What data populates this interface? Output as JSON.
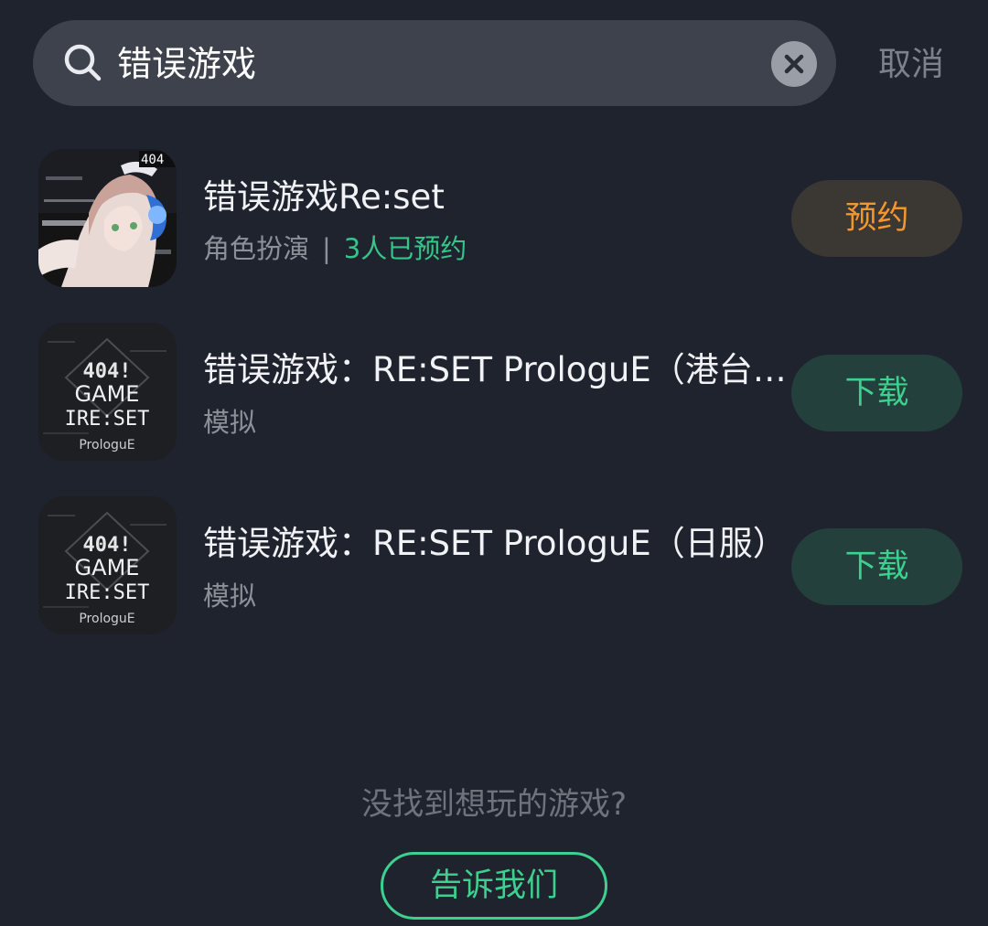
{
  "search": {
    "query": "错误游戏",
    "cancel_label": "取消"
  },
  "results": [
    {
      "title": "错误游戏Re:set",
      "category": "角色扮演",
      "separator": "|",
      "reservations": "3人已预约",
      "action_label": "预约"
    },
    {
      "title": "错误游戏：RE:SET ProloguE（港台…",
      "category": "模拟",
      "action_label": "下载",
      "icon_text": [
        "404!",
        "GAME",
        "IRE:SET",
        "ProloguE"
      ]
    },
    {
      "title": "错误游戏：RE:SET ProloguE（日服）",
      "category": "模拟",
      "action_label": "下载",
      "icon_text": [
        "404!",
        "GAME",
        "IRE:SET",
        "ProloguE"
      ]
    }
  ],
  "footer": {
    "hint": "没找到想玩的游戏?",
    "feedback_label": "告诉我们"
  },
  "colors": {
    "background": "#1f232e",
    "accent_green": "#3dd08f",
    "reserve_orange": "#f3962f"
  }
}
